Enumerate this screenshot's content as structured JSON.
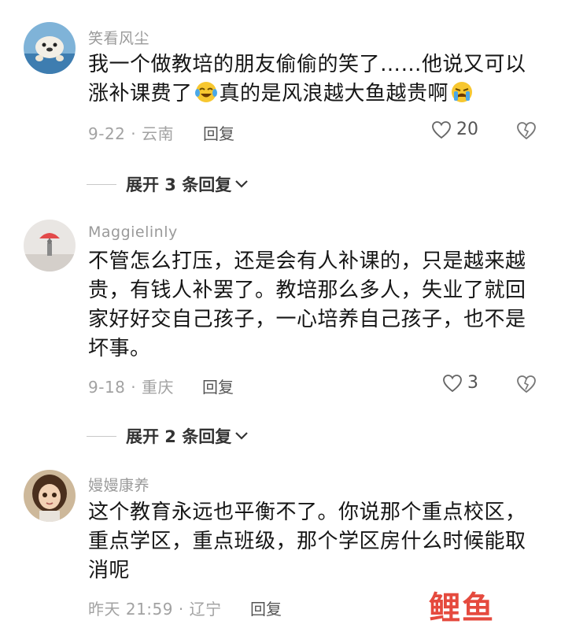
{
  "comments": [
    {
      "username": "笑看风尘",
      "text_a": "我一个做教培的朋友偷偷的笑了……他说又可以涨补课费了",
      "text_b": "真的是风浪越大鱼越贵啊",
      "emoji_1": "tears-of-joy-emoji",
      "emoji_2": "crying-emoji",
      "date": "9-22 · 云南",
      "reply_label": "回复",
      "likes": "20",
      "expand_label": "展开 3 条回复"
    },
    {
      "username": "Maggielinly",
      "text": "不管怎么打压，还是会有人补课的，只是越来越贵，有钱人补罢了。教培那么多人，失业了就回家好好交自己孩子，一心培养自己孩子，也不是坏事。",
      "date": "9-18 · 重庆",
      "reply_label": "回复",
      "likes": "3",
      "expand_label": "展开 2 条回复"
    },
    {
      "username": "嫚嫚康养",
      "text": "这个教育永远也平衡不了。你说那个重点校区，重点学区，重点班级，那个学区房什么时候能取消呢",
      "date": "昨天 21:59 · 辽宁",
      "reply_label": "回复"
    }
  ],
  "watermark": "鲤鱼",
  "colors": {
    "meta": "#a2a2a2",
    "text": "#161616",
    "watermark": "#e33b2e"
  }
}
